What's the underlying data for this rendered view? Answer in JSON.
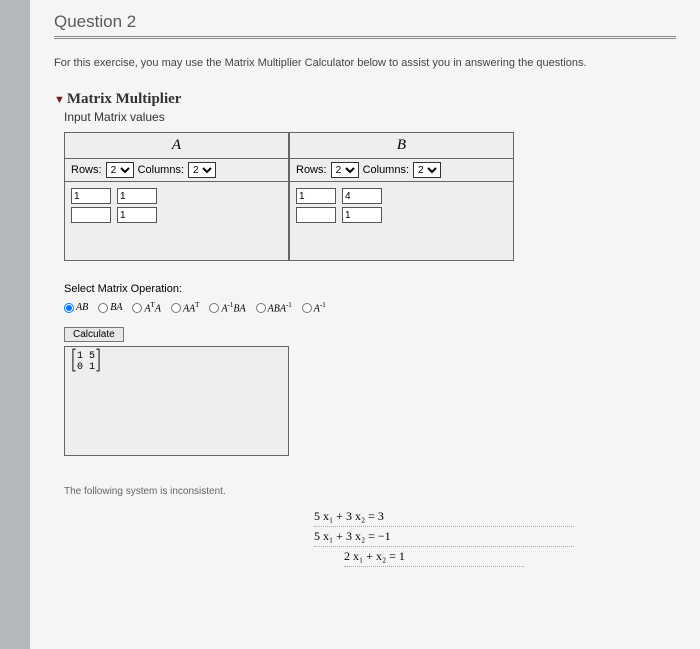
{
  "question": {
    "title": "Question 2"
  },
  "intro_text": "For this exercise, you may use the Matrix Multiplier Calculator below to assist you in answering the questions.",
  "tool": {
    "title": "Matrix Multiplier",
    "subtitle": "Input Matrix values"
  },
  "matrix_a": {
    "label": "A",
    "rows_label": "Rows:",
    "cols_label": "Columns:",
    "rows": "2",
    "cols": "2",
    "cells": [
      [
        "1",
        "1"
      ],
      [
        "",
        "1"
      ]
    ]
  },
  "matrix_b": {
    "label": "B",
    "rows_label": "Rows:",
    "cols_label": "Columns:",
    "rows": "2",
    "cols": "2",
    "cells": [
      [
        "1",
        "4"
      ],
      [
        "",
        "1"
      ]
    ]
  },
  "operation": {
    "label": "Select Matrix Operation:",
    "options": [
      "AB",
      "BA",
      "AᵀA",
      "AAᵀ",
      "A⁻¹BA",
      "ABA⁻¹",
      "A⁻¹"
    ],
    "selected": "AB"
  },
  "calculate_label": "Calculate",
  "result_text": "⎡1 5⎤\n⎣0 1⎦",
  "system": {
    "note": "The following system is inconsistent.",
    "eq1": "5 x₁ + 3 x₂ = 3",
    "eq2": "5 x₁ + 3 x₂ = −1",
    "eq3": "2 x₁ + x₂ = 1"
  }
}
